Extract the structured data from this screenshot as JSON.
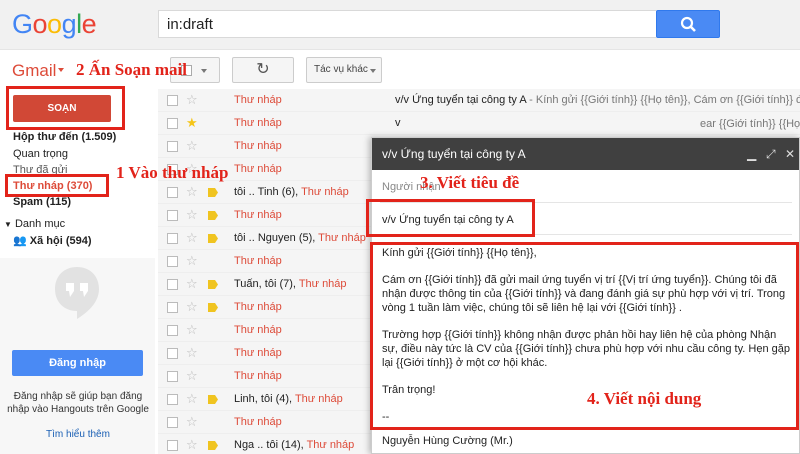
{
  "header": {
    "logo_letters": [
      {
        "ch": "G",
        "color": "#4285F4"
      },
      {
        "ch": "o",
        "color": "#EA4335"
      },
      {
        "ch": "o",
        "color": "#FBBC05"
      },
      {
        "ch": "g",
        "color": "#4285F4"
      },
      {
        "ch": "l",
        "color": "#34A853"
      },
      {
        "ch": "e",
        "color": "#EA4335"
      }
    ],
    "search_value": "in:draft"
  },
  "toolbar": {
    "gmail_label": "Gmail",
    "more_label": "Tác vụ khác"
  },
  "sidebar": {
    "compose_label": "SOẠN",
    "items": [
      {
        "label": "Hộp thư đến (1.509)"
      },
      {
        "label": "Quan trọng"
      },
      {
        "label": "Thư đã gửi"
      },
      {
        "label": "Thư nháp (370)"
      },
      {
        "label": "Spam (115)"
      },
      {
        "label": "Danh mục"
      },
      {
        "label": "Xã hội (594)"
      }
    ],
    "hangouts": {
      "signin_label": "Đăng nhập",
      "text": "Đăng nhập sẽ giúp bạn đăng nhập vào Hangouts trên Google",
      "link": "Tìm hiểu thêm"
    }
  },
  "rows": [
    {
      "sender": "",
      "draft": "Thư nháp",
      "starred": false,
      "label": false,
      "subject": "v/v Ứng tuyển tại công ty A",
      "snippet": " - Kính gửi {{Giới tính}} {{Họ tên}}, Cám ơn {{Giới tính}} đ"
    },
    {
      "sender": "",
      "draft": "Thư nháp",
      "starred": true,
      "label": false,
      "subject": "v",
      "snippet": ""
    },
    {
      "sender": "",
      "draft": "Thư nháp",
      "starred": false,
      "label": false,
      "subject": "",
      "snippet": ""
    },
    {
      "sender": "",
      "draft": "Thư nháp",
      "starred": false,
      "label": false,
      "subject": "",
      "snippet": ""
    },
    {
      "sender": "tôi .. Tinh (6), ",
      "draft": "Thư nháp",
      "starred": false,
      "label": true,
      "subject": "",
      "snippet": ""
    },
    {
      "sender": "",
      "draft": "Thư nháp",
      "starred": false,
      "label": true,
      "subject": "",
      "snippet": ""
    },
    {
      "sender": "tôi .. Nguyen (5), ",
      "draft": "Thư nháp",
      "starred": false,
      "label": true,
      "subject": "",
      "snippet": ""
    },
    {
      "sender": "",
      "draft": "Thư nháp",
      "starred": false,
      "label": false,
      "subject": "",
      "snippet": ""
    },
    {
      "sender": "Tuấn, tôi (7), ",
      "draft": "Thư nháp",
      "starred": false,
      "label": true,
      "subject": "",
      "snippet": ""
    },
    {
      "sender": "",
      "draft": "Thư nháp",
      "starred": false,
      "label": true,
      "subject": "",
      "snippet": ""
    },
    {
      "sender": "",
      "draft": "Thư nháp",
      "starred": false,
      "label": false,
      "subject": "",
      "snippet": ""
    },
    {
      "sender": "",
      "draft": "Thư nháp",
      "starred": false,
      "label": false,
      "subject": "",
      "snippet": ""
    },
    {
      "sender": "",
      "draft": "Thư nháp",
      "starred": false,
      "label": false,
      "subject": "",
      "snippet": ""
    },
    {
      "sender": "Linh, tôi (4), ",
      "draft": "Thư nháp",
      "starred": false,
      "label": true,
      "subject": "",
      "snippet": ""
    },
    {
      "sender": "",
      "draft": "Thư nháp",
      "starred": false,
      "label": false,
      "subject": "",
      "snippet": ""
    },
    {
      "sender": "Nga .. tôi (14), ",
      "draft": "Thư nháp",
      "starred": false,
      "label": true,
      "subject": "",
      "snippet": ""
    }
  ],
  "right_peek": [
    {
      "text": "ear {{Giới tính}} {{Họ tên}}, C"
    }
  ],
  "compose": {
    "title": "v/v Ứng tuyển tại công ty A",
    "recipients_placeholder": "Người nhận",
    "subject": "v/v Ứng tuyển tại công ty A",
    "body": [
      "Kính gửi {{Giới tính}} {{Họ tên}},",
      "Cám ơn {{Giới tính}} đã gửi mail ứng tuyển vị trí {{Vị trí ứng tuyển}}. Chúng tôi đã nhận được thông tin của {{Giới tính}} và đang đánh giá sự phù hợp với vị trí. Trong vòng 1 tuần làm việc, chúng tôi sẽ liên hệ lại với {{Giới tính}} .",
      "Trường hợp {{Giới tính}} không nhận được phản hồi hay liên hệ của phòng Nhận sự, điều này tức là CV của {{Giới tính}} chưa phù hợp với nhu cầu công ty. Hẹn gặp lại {{Giới tính}} ở một cơ hội khác.",
      "Trân trọng!",
      "--"
    ],
    "signature": "Nguyễn Hùng Cường (Mr.)"
  },
  "annotations": {
    "step1": "1 Vào thư nháp",
    "step2": "2 Ấn Soạn mail",
    "step3": "3. Viết tiêu đề",
    "step4": "4. Viết nội dung",
    "color": "#e2231a"
  }
}
